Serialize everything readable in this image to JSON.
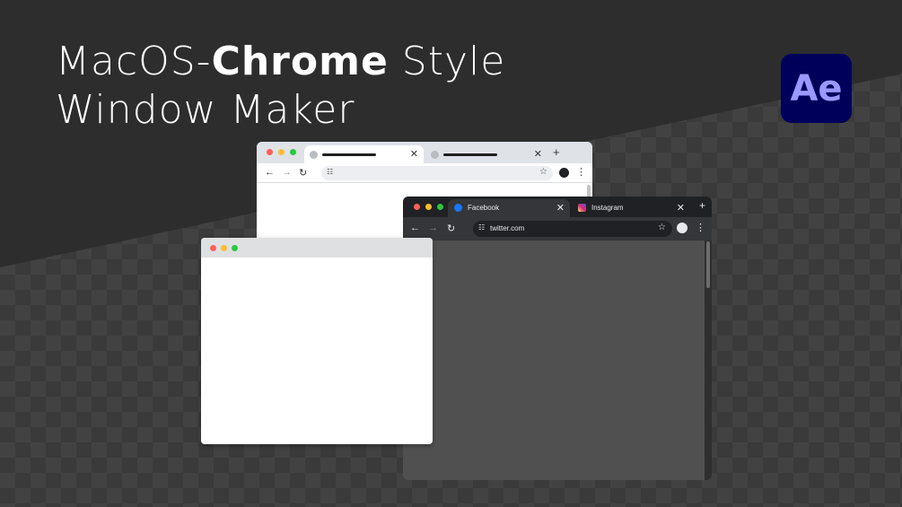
{
  "headline": {
    "line1_prefix": "MacOS-",
    "line1_bold": "Chrome",
    "line1_suffix": " Style",
    "line2": "Window Maker"
  },
  "app_logo": {
    "text": "Ae",
    "icon": "after-effects-icon",
    "bg": "#00005b",
    "fg": "#9999ff"
  },
  "light_window": {
    "theme": "light",
    "tabs": [
      {
        "state": "active"
      },
      {
        "state": "inactive"
      }
    ],
    "nav_icons": [
      "back-arrow-icon",
      "forward-arrow-icon",
      "reload-icon"
    ],
    "omnibox_url": ""
  },
  "dark_window": {
    "theme": "dark",
    "tabs": [
      {
        "label": "Facebook",
        "icon": "facebook-icon",
        "state": "active"
      },
      {
        "label": "Instagram",
        "icon": "instagram-icon",
        "state": "inactive"
      }
    ],
    "omnibox_url": "twitter.com"
  },
  "plain_window": {
    "theme": "light"
  },
  "colors": {
    "traffic_red": "#ff5f57",
    "traffic_yellow": "#febc2e",
    "traffic_green": "#28c840",
    "background": "#2d2d2d"
  }
}
